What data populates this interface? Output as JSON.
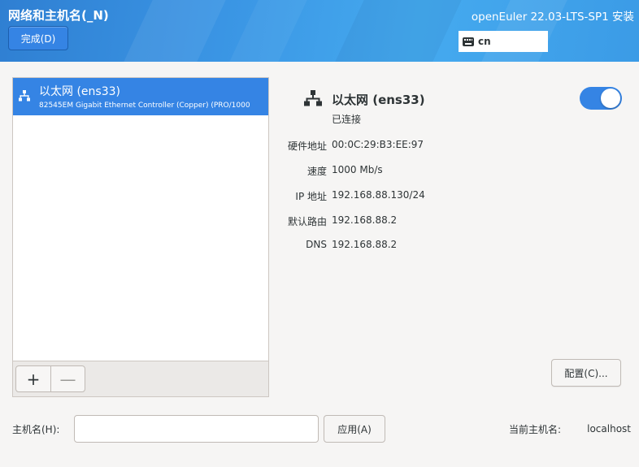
{
  "header": {
    "title": "网络和主机名(_N)",
    "done_label": "完成(D)",
    "product_title": "openEuler 22.03-LTS-SP1 安装",
    "keyboard_layout": "cn"
  },
  "devices": [
    {
      "name": "以太网 (ens33)",
      "description": "82545EM Gigabit Ethernet Controller (Copper) (PRO/1000",
      "selected": true,
      "icon": "network-wired-icon"
    }
  ],
  "list_toolbar": {
    "add_label": "+",
    "remove_label": "—"
  },
  "details": {
    "name": "以太网 (ens33)",
    "status": "已连接",
    "enabled": true,
    "rows": [
      {
        "label": "硬件地址",
        "value": "00:0C:29:B3:EE:97"
      },
      {
        "label": "速度",
        "value": "1000 Mb/s"
      },
      {
        "label": "IP 地址",
        "value": "192.168.88.130/24"
      },
      {
        "label": "默认路由",
        "value": "192.168.88.2"
      },
      {
        "label": "DNS",
        "value": "192.168.88.2"
      }
    ],
    "configure_label": "配置(C)..."
  },
  "hostname": {
    "label": "主机名(H):",
    "value": "",
    "apply_label": "应用(A)",
    "current_label": "当前主机名:",
    "current_value": "localhost"
  },
  "colors": {
    "accent": "#3584e4",
    "header_gradient": [
      "#2f7fd2",
      "#45aaef"
    ],
    "background": "#f6f5f4"
  }
}
